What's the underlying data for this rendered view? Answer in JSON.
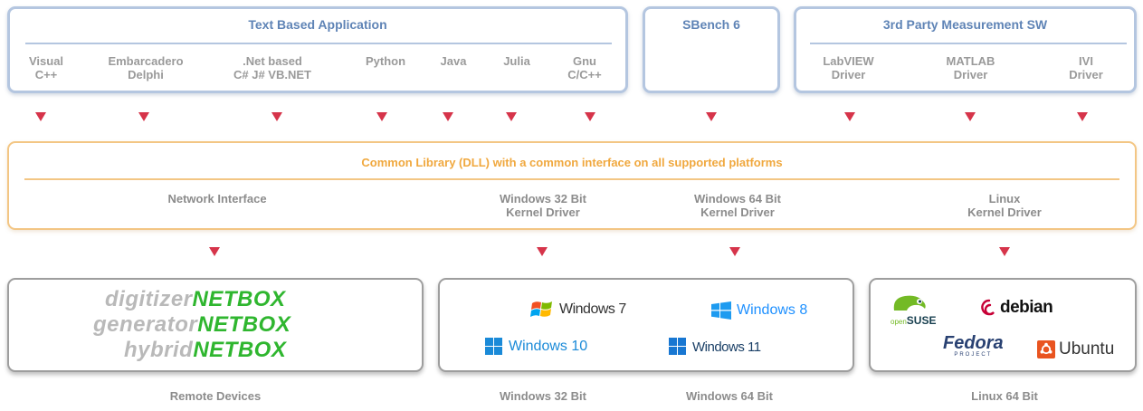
{
  "text_app": {
    "title": "Text Based Application",
    "items": [
      {
        "label": "Visual\nC++"
      },
      {
        "label": "Embarcadero\nDelphi"
      },
      {
        "label": ".Net based\nC#  J#  VB.NET"
      },
      {
        "label": "Python"
      },
      {
        "label": "Java"
      },
      {
        "label": "Julia"
      },
      {
        "label": "Gnu\nC/C++"
      }
    ]
  },
  "sbench": {
    "title": "SBench 6"
  },
  "third_party": {
    "title": "3rd Party Measurement SW",
    "items": [
      {
        "label": "LabVIEW\nDriver"
      },
      {
        "label": "MATLAB\nDriver"
      },
      {
        "label": "IVI\nDriver"
      }
    ]
  },
  "common_lib": {
    "title": "Common Library (DLL) with a common interface on all supported platforms",
    "items": [
      {
        "label": "Network Interface"
      },
      {
        "label": "Windows 32 Bit\nKernel Driver"
      },
      {
        "label": "Windows 64 Bit\nKernel Driver"
      },
      {
        "label": "Linux\nKernel Driver"
      }
    ]
  },
  "netbox": {
    "lines": [
      {
        "prefix": "digitizer",
        "suffix": "NETBOX"
      },
      {
        "prefix": "generator",
        "suffix": "NETBOX"
      },
      {
        "prefix": "hybrid",
        "suffix": "NETBOX"
      }
    ]
  },
  "windows": {
    "win7": "Windows 7",
    "win8": "Windows 8",
    "win10": "Windows 10",
    "win11": "Windows 11"
  },
  "linux": {
    "opensuse": "openSUSE",
    "opensuse_small": "open",
    "opensuse_big": "SUSE",
    "debian": "debian",
    "fedora": "Fedora",
    "fedora_sub": "PROJECT",
    "ubuntu": "Ubuntu"
  },
  "footers": {
    "remote": "Remote Devices",
    "win32": "Windows 32 Bit",
    "win64": "Windows 64 Bit",
    "linux64": "Linux 64 Bit"
  },
  "colors": {
    "blue_border": "#b4c6e0",
    "blue_text": "#5f84b6",
    "orange_border": "#f3c684",
    "orange_text": "#f0a83e",
    "arrow": "#d6344a",
    "netbox_green": "#2fb62f"
  }
}
